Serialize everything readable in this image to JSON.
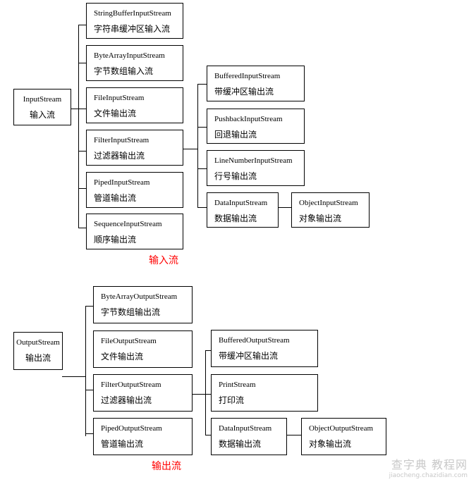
{
  "input": {
    "root": {
      "en": "InputStream",
      "cn": "输入流"
    },
    "children": [
      {
        "en": "StringBufferInputStream",
        "cn": "字符串缓冲区输入流"
      },
      {
        "en": "ByteArrayInputStream",
        "cn": "字节数组输入流"
      },
      {
        "en": "FileInputStream",
        "cn": "文件输出流"
      },
      {
        "en": "FilterInputStream",
        "cn": "过滤器输出流"
      },
      {
        "en": "PipedInputStream",
        "cn": "管道输出流"
      },
      {
        "en": "SequenceInputStream",
        "cn": "顺序输出流"
      }
    ],
    "filter_children": [
      {
        "en": "BufferedInputStream",
        "cn": "带缓冲区输出流"
      },
      {
        "en": "PushbackInputStream",
        "cn": "回退输出流"
      },
      {
        "en": "LineNumberInputStream",
        "cn": "行号输出流"
      },
      {
        "en": "DataInputStream",
        "cn": "数据输出流"
      }
    ],
    "data_child": {
      "en": "ObjectInputStream",
      "cn": "对象输出流"
    },
    "caption": "输入流"
  },
  "output": {
    "root": {
      "en": "OutputStream",
      "cn": "输出流"
    },
    "children": [
      {
        "en": "ByteArrayOutputStream",
        "cn": "字节数组输出流"
      },
      {
        "en": "FileOutputStream",
        "cn": "文件输出流"
      },
      {
        "en": "FilterOutputStream",
        "cn": "过滤器输出流"
      },
      {
        "en": "PipedOutputStream",
        "cn": "管道输出流"
      }
    ],
    "filter_children": [
      {
        "en": "BufferedOutputStream",
        "cn": "带缓冲区输出流"
      },
      {
        "en": "PrintStream",
        "cn": "打印流"
      },
      {
        "en": "DataInputStream",
        "cn": "数据输出流"
      }
    ],
    "data_child": {
      "en": "ObjectOutputStream",
      "cn": "对象输出流"
    },
    "caption": "输出流"
  },
  "colors": {
    "caption": "#ff0000",
    "line": "#000000",
    "watermark": "#c8c8c8"
  },
  "watermark": {
    "title": "查字典 教程网",
    "url": "jiaocheng.chazidian.com"
  }
}
